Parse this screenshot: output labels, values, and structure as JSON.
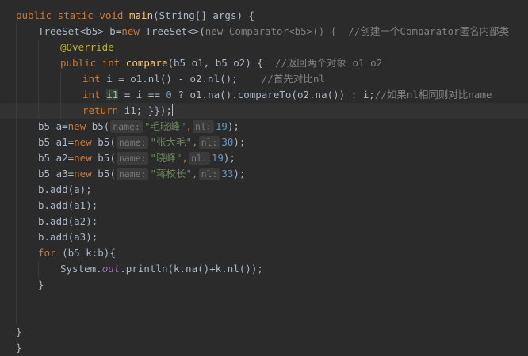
{
  "code": {
    "l1": {
      "kw1": "public static void ",
      "fn": "main",
      "rest": "(String[] args) {"
    },
    "l2": {
      "t1": "TreeSet<b5> b=",
      "kw": "new ",
      "t2": "TreeSet<>(",
      "g": "new Comparator<b5>() {",
      "t3": "  ",
      "cm": "//创建一个Comparator匿名内部类"
    },
    "l3": {
      "ann": "@Override"
    },
    "l4": {
      "kw": "public int ",
      "fn": "compare",
      "t1": "(b5 o1, b5 o2) {  ",
      "cm": "//返回两个对象 o1 o2"
    },
    "l5": {
      "kw": "int ",
      "t1": "i = o1.nl() - o2.nl();    ",
      "cm": "//首先对比nl"
    },
    "l6": {
      "kw": "int ",
      "hl": "i1",
      "t1": " = i == ",
      "num": "0",
      "t2": " ? o1.na().compareTo(o2.na()) : i;",
      "cm": "//如果nl相同则对比name"
    },
    "l7": {
      "kw": "return ",
      "t1": "i1; ",
      "t2": "}});"
    },
    "l8": {
      "t1": "b5 a=",
      "kw": "new ",
      "t2": "b5(",
      "hn": "name:",
      "s": "\"毛晓峰\"",
      "c": ",",
      "hnl": "nl:",
      "n": "19",
      "e": ");"
    },
    "l9": {
      "t1": "b5 a1=",
      "kw": "new ",
      "t2": "b5(",
      "hn": "name:",
      "s": "\"张大毛\"",
      "c": ",",
      "hnl": "nl:",
      "n": "30",
      "e": ");"
    },
    "l10": {
      "t1": "b5 a2=",
      "kw": "new ",
      "t2": "b5(",
      "hn": "name:",
      "s": "\"晓峰\"",
      "c": ",",
      "hnl": "nl:",
      "n": "19",
      "e": ");"
    },
    "l11": {
      "t1": "b5 a3=",
      "kw": "new ",
      "t2": "b5(",
      "hn": "name:",
      "s": "\"蒋校长\"",
      "c": ",",
      "hnl": "nl:",
      "n": "33",
      "e": ");"
    },
    "l12": {
      "t": "b.add(a);"
    },
    "l13": {
      "t": "b.add(a1);"
    },
    "l14": {
      "t": "b.add(a2);"
    },
    "l15": {
      "t": "b.add(a3);"
    },
    "l16": {
      "kw": "for ",
      "t": "(b5 k:b){"
    },
    "l17": {
      "t1": "System.",
      "fld": "out",
      "t2": ".println(k.na()+k.nl());"
    },
    "l18": {
      "t": "}"
    },
    "l19": {
      "t": "}"
    },
    "l20": {
      "t": "}"
    }
  },
  "colors": {
    "background": "#2b2b2b",
    "keyword": "#cc7832",
    "method": "#ffc66d",
    "string": "#6a8759",
    "number": "#6897bb",
    "comment": "#808080",
    "annotation": "#bbb529"
  }
}
